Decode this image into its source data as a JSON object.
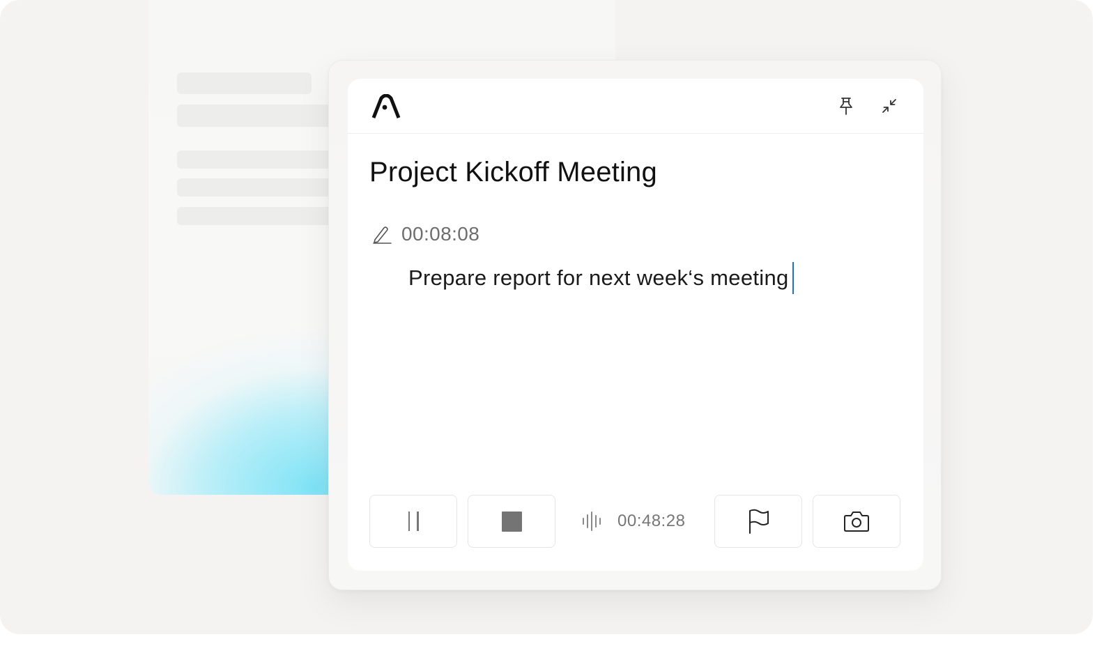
{
  "note": {
    "title": "Project Kickoff Meeting",
    "timestamp": "00:08:08",
    "text": "Prepare report for next week‘s meeting"
  },
  "recording": {
    "elapsed": "00:48:28",
    "state": "recording"
  },
  "icons": {
    "logo": "app-logo-icon",
    "pin": "pin-icon",
    "collapse": "collapse-icon",
    "edit": "pen-icon",
    "pause": "pause-icon",
    "stop": "stop-icon",
    "waveform": "audio-waveform-icon",
    "flag": "flag-icon",
    "camera": "camera-icon"
  },
  "colors": {
    "caret": "#1f6fd6",
    "accent_glow": "#7ee3f6",
    "text_primary": "#111111",
    "text_secondary": "#6e6e6e"
  }
}
